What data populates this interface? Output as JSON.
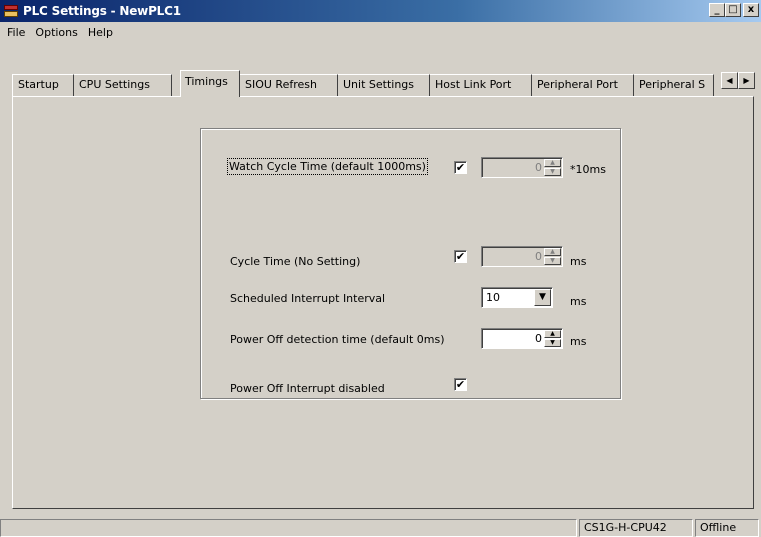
{
  "window": {
    "title": "PLC Settings - NewPLC1",
    "minimize": "_",
    "maximize": "□",
    "close": "x"
  },
  "menu": [
    "File",
    "Options",
    "Help"
  ],
  "tabs": [
    "Startup",
    "CPU Settings",
    "Timings",
    "SIOU Refresh",
    "Unit Settings",
    "Host Link Port",
    "Peripheral Port",
    "Peripheral S"
  ],
  "active_tab": "Timings",
  "tab_scroll": {
    "left": "◀",
    "right": "▶"
  },
  "timings": {
    "watch_cycle": {
      "label": "Watch Cycle Time (default 1000ms)",
      "checked": "✔",
      "value": "0",
      "unit": "*10ms"
    },
    "cycle_time": {
      "label": "Cycle Time (No Setting)",
      "checked": "✔",
      "value": "0",
      "unit": "ms"
    },
    "scheduled_interrupt": {
      "label": "Scheduled Interrupt Interval",
      "value": "10",
      "unit": "ms"
    },
    "power_off_detection": {
      "label": "Power Off detection time (default 0ms)",
      "value": "0",
      "unit": "ms"
    },
    "power_off_interrupt": {
      "label": "Power Off Interrupt disabled",
      "checked": "✔"
    }
  },
  "status": {
    "model": "CS1G-H-CPU42",
    "mode": "Offline"
  }
}
